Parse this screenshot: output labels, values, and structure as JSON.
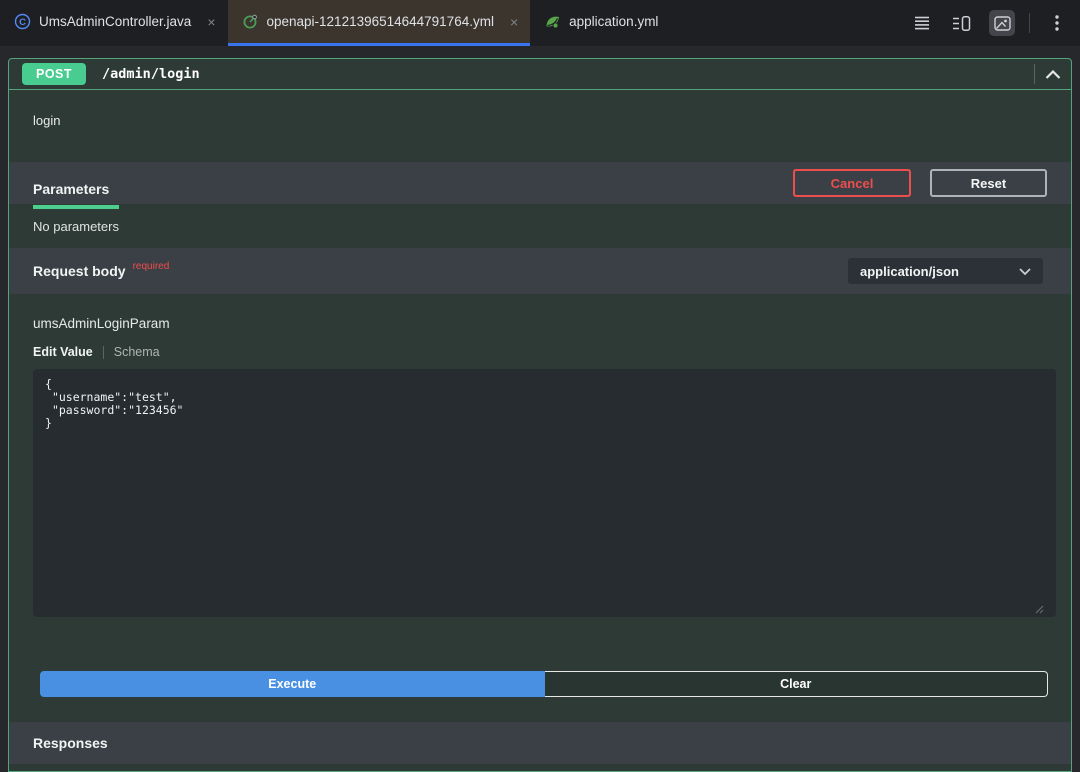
{
  "editor": {
    "tabs": [
      {
        "label": "UmsAdminController.java",
        "icon": "java-class-icon"
      },
      {
        "label": "openapi-12121396514644791764.yml",
        "icon": "openapi-icon"
      },
      {
        "label": "application.yml",
        "icon": "spring-boot-icon"
      }
    ],
    "close_glyph": "×"
  },
  "operation": {
    "method": "POST",
    "path": "/admin/login",
    "summary": "login",
    "parameters_section": {
      "title": "Parameters",
      "cancel_label": "Cancel",
      "reset_label": "Reset",
      "empty_message": "No parameters"
    },
    "request_body_section": {
      "title": "Request body",
      "required_label": "required",
      "content_type": "application/json",
      "schema_name": "umsAdminLoginParam",
      "edit_tab_label": "Edit Value",
      "schema_tab_label": "Schema",
      "body_json": "{\n \"username\":\"test\",\n \"password\":\"123456\"\n}"
    },
    "execute_label": "Execute",
    "clear_label": "Clear",
    "responses_section": {
      "title": "Responses"
    }
  },
  "colors": {
    "method_green": "#49cc90",
    "panel_border_green": "#55a47e",
    "active_tab_underline_blue": "#3674f0",
    "execute_blue": "#4990e2",
    "cancel_red": "#ed4e4e",
    "required_red": "#f24c4c",
    "section_band_gray": "#3a4045",
    "panel_background": "#2d3a35"
  }
}
